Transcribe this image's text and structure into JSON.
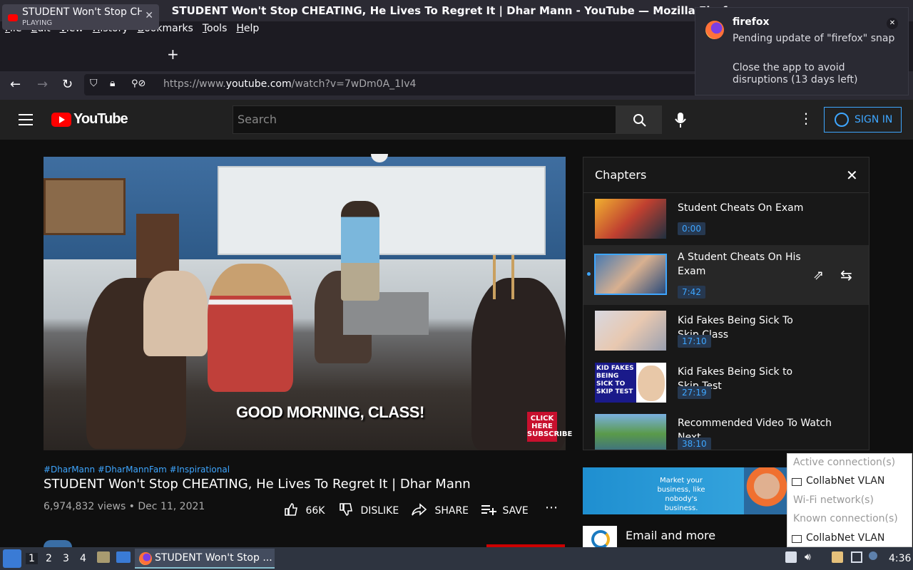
{
  "window": {
    "title": "STUDENT Won't Stop CHEATING, He Lives To Regret It | Dhar Mann - YouTube — Mozilla Firefox"
  },
  "menu": [
    "File",
    "Edit",
    "View",
    "History",
    "Bookmarks",
    "Tools",
    "Help"
  ],
  "tab": {
    "title": "STUDENT Won't Stop CHEATING",
    "status": "PLAYING"
  },
  "url": {
    "prefix": "https://www.",
    "domain": "youtube.com",
    "path": "/watch?v=7wDm0A_1Iv4"
  },
  "notification": {
    "app": "firefox",
    "line1": "Pending update of \"firefox\" snap",
    "line2": "Close the app to avoid disruptions (13 days left)"
  },
  "youtube": {
    "logo": "YouTube",
    "search_placeholder": "Search",
    "sign_in": "SIGN IN"
  },
  "video": {
    "caption": "GOOD MORNING, CLASS!",
    "click_here": "CLICK HERE SUBSCRIBE",
    "hashtags": "#DharMann #DharMannFam #Inspirational",
    "title": "STUDENT Won't Stop CHEATING, He Lives To Regret It | Dhar Mann",
    "views": "6,974,832 views",
    "date": "Dec 11, 2021",
    "likes": "66K",
    "dislike": "DISLIKE",
    "share": "SHARE",
    "save": "SAVE"
  },
  "chapters": {
    "header": "Chapters",
    "items": [
      {
        "title": "Student Cheats On Exam",
        "time": "0:00"
      },
      {
        "title": "A Student Cheats On His Exam",
        "time": "7:42"
      },
      {
        "title": "Kid Fakes Being Sick To Skip Class",
        "time": "17:10"
      },
      {
        "title": "Kid Fakes Being Sick to Skip Test",
        "time": "27:19"
      },
      {
        "title": "Recommended Video To Watch Next",
        "time": "38:10"
      }
    ],
    "thumb4_text": "KID FAKES BEING SICK TO SKIP TEST"
  },
  "ad": {
    "text": "Market your business, like nobody's business.",
    "email": "Email and more"
  },
  "network_menu": {
    "active_header": "Active connection(s)",
    "active_item": "CollabNet VLAN",
    "wifi_header": "Wi-Fi network(s)",
    "known_header": "Known connection(s)",
    "known_item": "CollabNet VLAN"
  },
  "taskbar": {
    "workspaces": [
      "1",
      "2",
      "3",
      "4"
    ],
    "task_title": "STUDENT Won't Stop ...",
    "clock": "4:36"
  }
}
